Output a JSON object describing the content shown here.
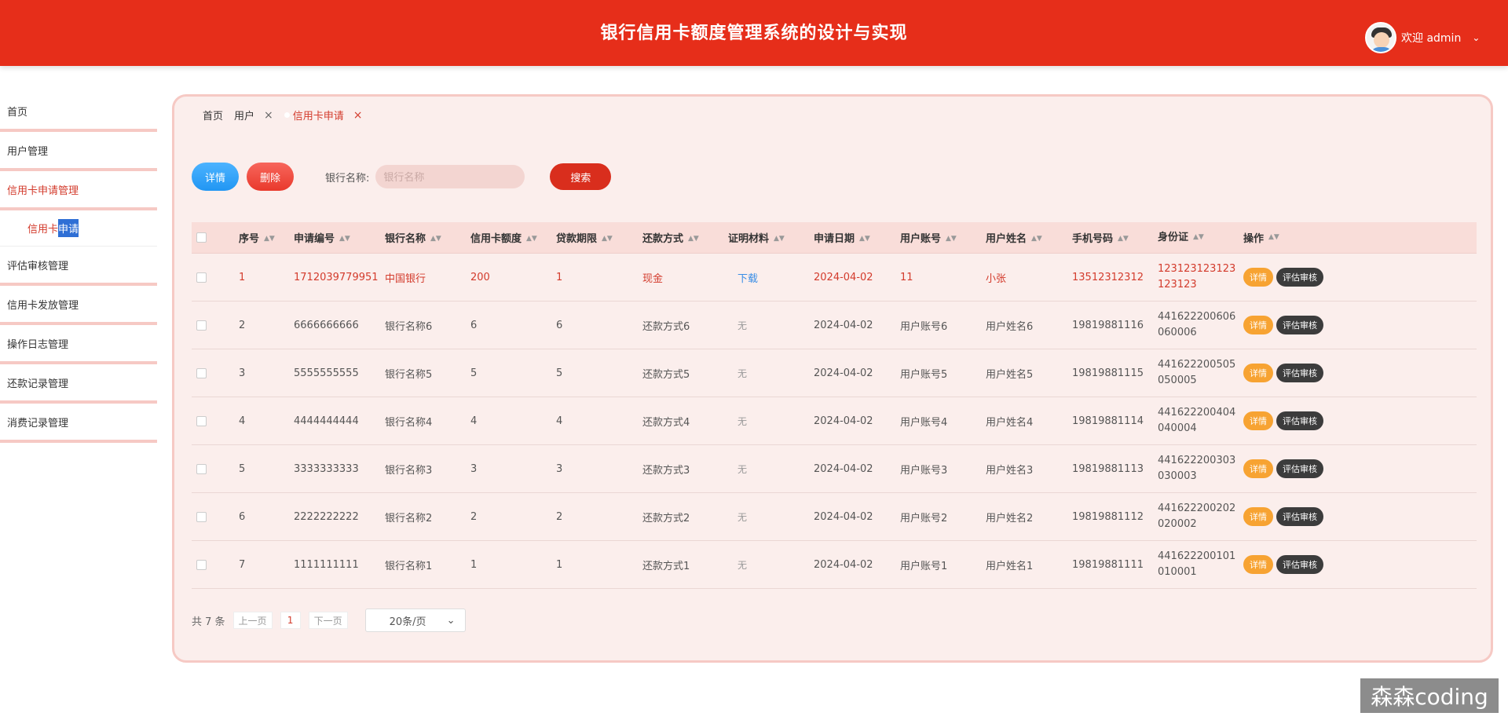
{
  "header": {
    "title": "银行信用卡额度管理系统的设计与实现",
    "welcome": "欢迎 admin",
    "caret": "⌄"
  },
  "sidebar": {
    "items": [
      {
        "label": "首页"
      },
      {
        "label": "用户管理"
      },
      {
        "label": "信用卡申请管理"
      },
      {
        "label": "评估审核管理"
      },
      {
        "label": "信用卡发放管理"
      },
      {
        "label": "操作日志管理"
      },
      {
        "label": "还款记录管理"
      },
      {
        "label": "消费记录管理"
      }
    ],
    "sub_prefix": "信用卡",
    "sub_highlight": "申请"
  },
  "tabs": [
    {
      "label": "首页"
    },
    {
      "label": "用户",
      "close": "×"
    },
    {
      "label": "信用卡申请",
      "close": "×"
    }
  ],
  "toolbar": {
    "detail_label": "详情",
    "delete_label": "删除",
    "bank_label": "银行名称:",
    "bank_placeholder": "银行名称",
    "search_label": "搜索"
  },
  "table": {
    "headers": [
      "序号",
      "申请编号",
      "银行名称",
      "信用卡额度",
      "贷款期限",
      "还款方式",
      "证明材料",
      "申请日期",
      "用户账号",
      "用户姓名",
      "手机号码",
      "身份证",
      "操作"
    ],
    "rows": [
      {
        "no": "1",
        "app": "1712039779951",
        "bank": "中国银行",
        "quota": "200",
        "term": "1",
        "pay": "现金",
        "proof": "下载",
        "date": "2024-04-02",
        "acc": "11",
        "name": "小张",
        "phone": "13512312312",
        "id1": "123123123123",
        "id2": "123123"
      },
      {
        "no": "2",
        "app": "6666666666",
        "bank": "银行名称6",
        "quota": "6",
        "term": "6",
        "pay": "还款方式6",
        "proof": "无",
        "date": "2024-04-02",
        "acc": "用户账号6",
        "name": "用户姓名6",
        "phone": "19819881116",
        "id1": "441622200606",
        "id2": "060006"
      },
      {
        "no": "3",
        "app": "5555555555",
        "bank": "银行名称5",
        "quota": "5",
        "term": "5",
        "pay": "还款方式5",
        "proof": "无",
        "date": "2024-04-02",
        "acc": "用户账号5",
        "name": "用户姓名5",
        "phone": "19819881115",
        "id1": "441622200505",
        "id2": "050005"
      },
      {
        "no": "4",
        "app": "4444444444",
        "bank": "银行名称4",
        "quota": "4",
        "term": "4",
        "pay": "还款方式4",
        "proof": "无",
        "date": "2024-04-02",
        "acc": "用户账号4",
        "name": "用户姓名4",
        "phone": "19819881114",
        "id1": "441622200404",
        "id2": "040004"
      },
      {
        "no": "5",
        "app": "3333333333",
        "bank": "银行名称3",
        "quota": "3",
        "term": "3",
        "pay": "还款方式3",
        "proof": "无",
        "date": "2024-04-02",
        "acc": "用户账号3",
        "name": "用户姓名3",
        "phone": "19819881113",
        "id1": "441622200303",
        "id2": "030003"
      },
      {
        "no": "6",
        "app": "2222222222",
        "bank": "银行名称2",
        "quota": "2",
        "term": "2",
        "pay": "还款方式2",
        "proof": "无",
        "date": "2024-04-02",
        "acc": "用户账号2",
        "name": "用户姓名2",
        "phone": "19819881112",
        "id1": "441622200202",
        "id2": "020002"
      },
      {
        "no": "7",
        "app": "1111111111",
        "bank": "银行名称1",
        "quota": "1",
        "term": "1",
        "pay": "还款方式1",
        "proof": "无",
        "date": "2024-04-02",
        "acc": "用户账号1",
        "name": "用户姓名1",
        "phone": "19819881111",
        "id1": "441622200101",
        "id2": "010001"
      }
    ],
    "op_detail": "详情",
    "op_review": "评估审核"
  },
  "pager": {
    "total": "共 7 条",
    "prev": "上一页",
    "page": "1",
    "next": "下一页",
    "size": "20条/页",
    "size_caret": "⌄"
  },
  "watermark": "森森coding",
  "colors": {
    "header_bg": "#e62e1a",
    "accent_red": "#d33b2c",
    "panel_bg": "#fbeeec",
    "btn_blue": "#2196f3",
    "btn_orange": "#f7a332",
    "btn_dark": "#3c3c3c"
  }
}
